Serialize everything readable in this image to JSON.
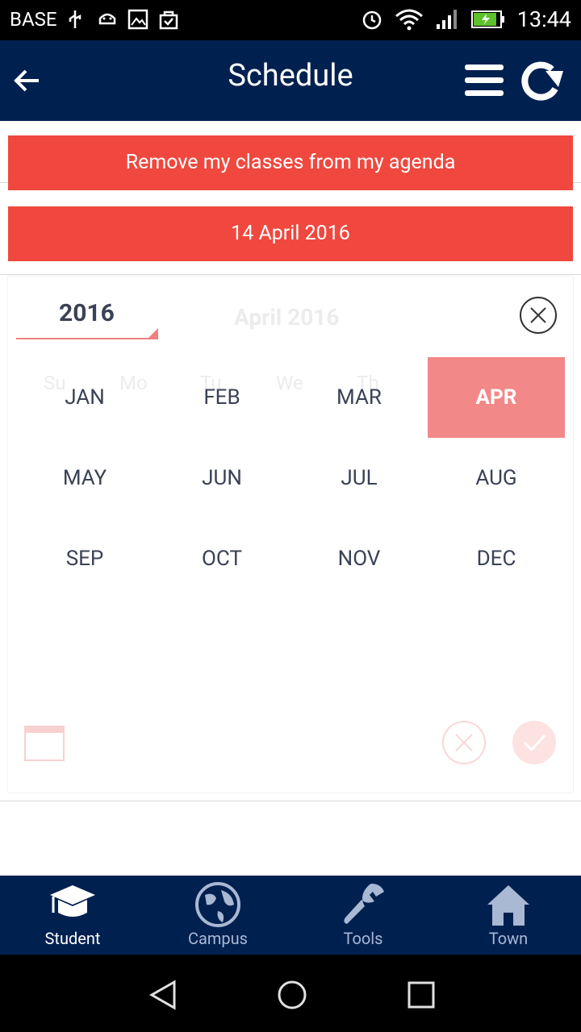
{
  "status": {
    "carrier": "BASE",
    "time": "13:44"
  },
  "appbar": {
    "title": "Schedule"
  },
  "actions": {
    "remove_classes": "Remove my classes from my agenda",
    "selected_date": "14 April 2016"
  },
  "picker": {
    "year": "2016",
    "ghost_header": "April 2016",
    "ghost_weekdays": [
      "Su",
      "Mo",
      "Tu",
      "We",
      "Th"
    ],
    "months": [
      "JAN",
      "FEB",
      "MAR",
      "APR",
      "MAY",
      "JUN",
      "JUL",
      "AUG",
      "SEP",
      "OCT",
      "NOV",
      "DEC"
    ],
    "selected_month": "APR"
  },
  "bottom_nav": [
    {
      "label": "Student",
      "icon": "graduation-cap-icon",
      "active": true
    },
    {
      "label": "Campus",
      "icon": "globe-icon",
      "active": false
    },
    {
      "label": "Tools",
      "icon": "wrench-icon",
      "active": false
    },
    {
      "label": "Town",
      "icon": "home-icon",
      "active": false
    }
  ],
  "colors": {
    "navy": "#002050",
    "red": "#f0483e",
    "selected": "#f28887",
    "inactive_nav": "#a9b8d3"
  }
}
